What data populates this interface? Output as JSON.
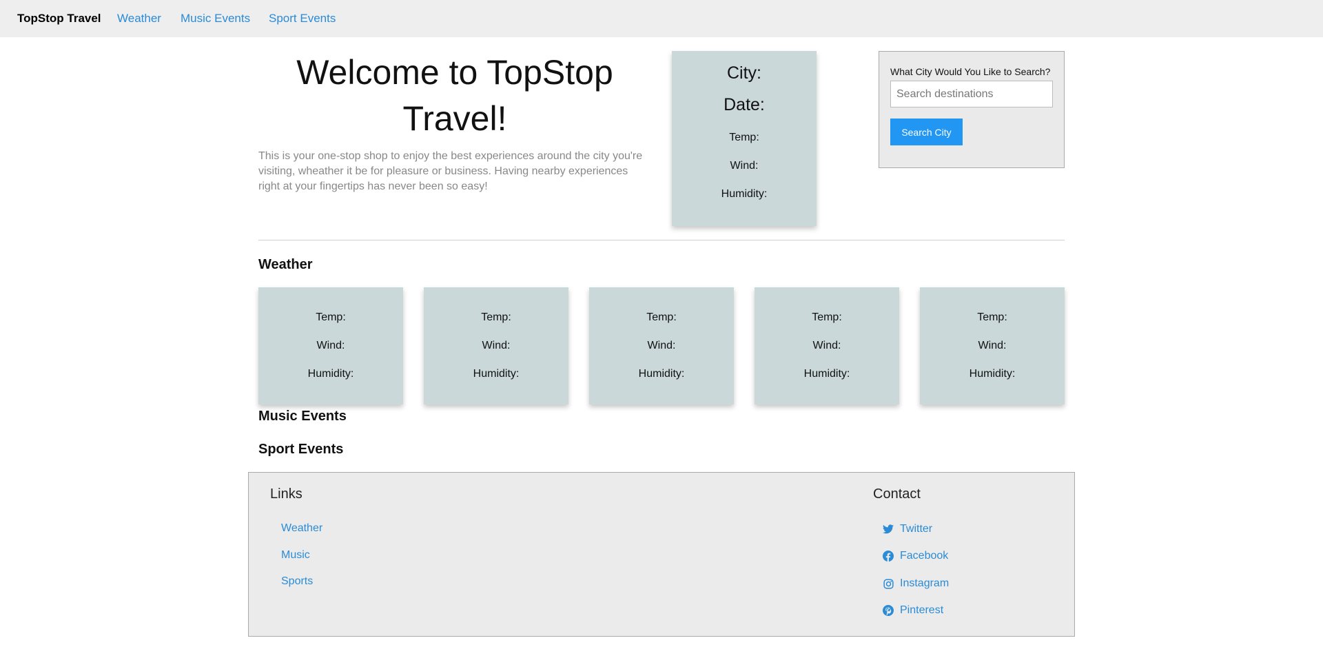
{
  "nav": {
    "brand": "TopStop Travel",
    "links": [
      "Weather",
      "Music Events",
      "Sport Events"
    ]
  },
  "hero": {
    "title": "Welcome to TopStop Travel!",
    "description": "This is your one-stop shop to enjoy the best experiences around the city you're visiting, wheather it be for pleasure or business. Having nearby experiences right at your fingertips has never been so easy!"
  },
  "current_weather": {
    "city_label": "City:",
    "date_label": "Date:",
    "temp_label": "Temp:",
    "wind_label": "Wind:",
    "humidity_label": "Humidity:"
  },
  "search": {
    "label": "What City Would You Like to Search?",
    "input_value": "",
    "placeholder": "Search destinations",
    "button_label": "Search City"
  },
  "sections": {
    "weather": "Weather",
    "music": "Music Events",
    "sports": "Sport Events"
  },
  "forecast": [
    {
      "temp": "Temp:",
      "wind": "Wind:",
      "humidity": "Humidity:"
    },
    {
      "temp": "Temp:",
      "wind": "Wind:",
      "humidity": "Humidity:"
    },
    {
      "temp": "Temp:",
      "wind": "Wind:",
      "humidity": "Humidity:"
    },
    {
      "temp": "Temp:",
      "wind": "Wind:",
      "humidity": "Humidity:"
    },
    {
      "temp": "Temp:",
      "wind": "Wind:",
      "humidity": "Humidity:"
    }
  ],
  "footer": {
    "links_heading": "Links",
    "links": [
      "Weather",
      "Music",
      "Sports"
    ],
    "contact_heading": "Contact",
    "social": [
      {
        "label": "Twitter",
        "icon": "twitter-icon"
      },
      {
        "label": "Facebook",
        "icon": "facebook-icon"
      },
      {
        "label": "Instagram",
        "icon": "instagram-icon"
      },
      {
        "label": "Pinterest",
        "icon": "pinterest-icon"
      }
    ]
  },
  "colors": {
    "link": "#2a8bd6",
    "button": "#2196f3",
    "card": "#cad8da",
    "nav_bg": "#eeeeee",
    "footer_bg": "#ebebeb"
  }
}
